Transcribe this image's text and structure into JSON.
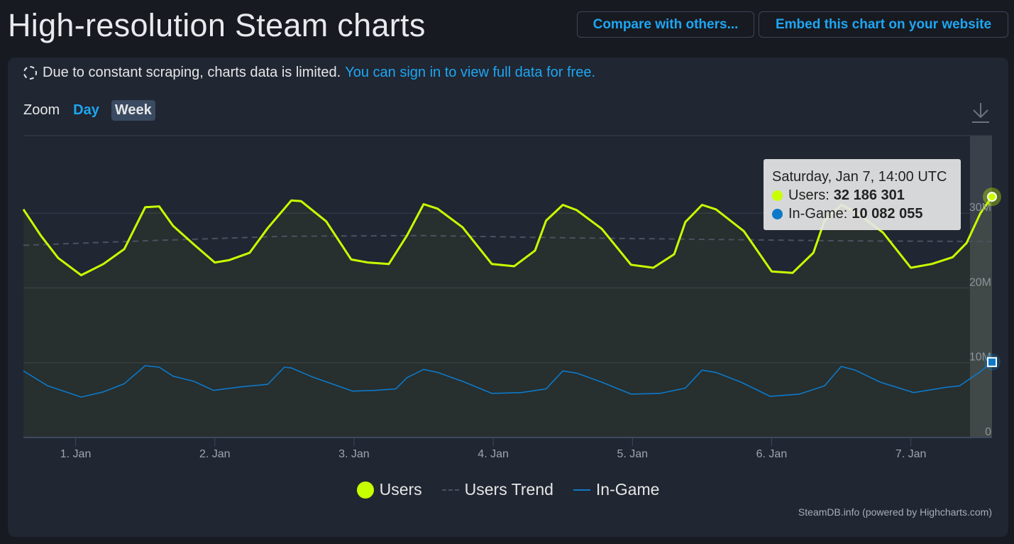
{
  "header": {
    "title": "High-resolution Steam charts",
    "compare_button": "Compare with others...",
    "embed_button": "Embed this chart on your website"
  },
  "notice": {
    "text": "Due to constant scraping, charts data is limited.",
    "link": "You can sign in to view full data for free."
  },
  "zoom": {
    "label": "Zoom",
    "options": [
      "Day",
      "Week"
    ],
    "selected": "Week"
  },
  "icons": {
    "download": "download-icon",
    "notice": "dashed-circle-icon"
  },
  "colors": {
    "users": "#c8ff00",
    "in_game": "#0d79c8",
    "trend": "#4a5260",
    "accent": "#1ea6f2"
  },
  "tooltip": {
    "date": "Saturday, Jan 7, 14:00 UTC",
    "users_label": "Users:",
    "users_value": "32 186 301",
    "ingame_label": "In-Game:",
    "ingame_value": "10 082 055"
  },
  "credits": "SteamDB.info (powered by Highcharts.com)",
  "chart_data": {
    "type": "line",
    "title": "",
    "xlabel": "",
    "ylabel": "",
    "x_unit": "days since 1. Jan 00:00 UTC",
    "xlim": [
      -0.375,
      6.583
    ],
    "ylim": [
      0,
      35000000
    ],
    "y_ticks": [
      0,
      10000000,
      20000000,
      30000000
    ],
    "y_tick_labels": [
      "0",
      "10M",
      "20M",
      "30M"
    ],
    "x_ticks": [
      0,
      1,
      2,
      3,
      4,
      5,
      6
    ],
    "x_tick_labels": [
      "1. Jan",
      "2. Jan",
      "3. Jan",
      "4. Jan",
      "5. Jan",
      "6. Jan",
      "7. Jan"
    ],
    "grid": true,
    "legend_position": "bottom",
    "series": [
      {
        "name": "Users",
        "style": "line-area",
        "x": [
          -0.375,
          -0.25,
          -0.125,
          0.04,
          0.2,
          0.35,
          0.5,
          0.6,
          0.7,
          0.85,
          1.0,
          1.1,
          1.25,
          1.38,
          1.55,
          1.62,
          1.8,
          1.98,
          2.1,
          2.25,
          2.38,
          2.5,
          2.6,
          2.78,
          2.99,
          3.15,
          3.3,
          3.38,
          3.5,
          3.6,
          3.78,
          3.99,
          4.15,
          4.3,
          4.38,
          4.5,
          4.6,
          4.8,
          5.0,
          5.15,
          5.3,
          5.38,
          5.5,
          5.6,
          5.8,
          6.0,
          6.15,
          6.3,
          6.4,
          6.5,
          6.583
        ],
        "values": [
          30500000,
          27000000,
          24000000,
          21700000,
          23200000,
          25200000,
          30800000,
          30900000,
          28300000,
          25800000,
          23400000,
          23700000,
          24700000,
          28000000,
          31700000,
          31600000,
          28900000,
          23800000,
          23400000,
          23200000,
          27000000,
          31200000,
          30600000,
          28100000,
          23200000,
          22900000,
          25000000,
          29000000,
          31100000,
          30400000,
          27900000,
          23100000,
          22700000,
          24500000,
          28800000,
          31100000,
          30500000,
          27600000,
          22200000,
          22000000,
          24700000,
          29000000,
          31100000,
          30200000,
          27400000,
          22700000,
          23200000,
          24100000,
          26000000,
          30000000,
          32186301
        ]
      },
      {
        "name": "Users Trend",
        "style": "dashed",
        "x": [
          -0.375,
          0.5,
          1.5,
          2.5,
          3.5,
          4.5,
          5.5,
          6.583
        ],
        "values": [
          25700000,
          26300000,
          26900000,
          27000000,
          26700000,
          26500000,
          26300000,
          26200000
        ]
      },
      {
        "name": "In-Game",
        "style": "line",
        "x": [
          -0.375,
          -0.2,
          0.04,
          0.2,
          0.35,
          0.5,
          0.6,
          0.7,
          0.85,
          0.99,
          1.2,
          1.38,
          1.5,
          1.55,
          1.7,
          1.99,
          2.15,
          2.3,
          2.38,
          2.5,
          2.6,
          2.78,
          2.99,
          3.2,
          3.38,
          3.5,
          3.6,
          3.78,
          3.99,
          4.2,
          4.38,
          4.5,
          4.6,
          4.78,
          4.99,
          5.2,
          5.38,
          5.5,
          5.6,
          5.78,
          6.02,
          6.25,
          6.35,
          6.5,
          6.583
        ],
        "values": [
          8900000,
          6900000,
          5400000,
          6100000,
          7200000,
          9600000,
          9400000,
          8200000,
          7500000,
          6300000,
          6800000,
          7100000,
          9400000,
          9300000,
          8100000,
          6200000,
          6300000,
          6500000,
          8000000,
          9100000,
          8700000,
          7500000,
          5900000,
          6000000,
          6500000,
          8900000,
          8600000,
          7400000,
          5800000,
          5900000,
          6600000,
          9000000,
          8700000,
          7400000,
          5500000,
          5800000,
          6900000,
          9500000,
          9000000,
          7400000,
          6000000,
          6700000,
          6900000,
          8800000,
          10082055
        ]
      }
    ],
    "tooltip_point": {
      "x": 6.583,
      "Users": 32186301,
      "In-Game": 10082055
    }
  }
}
